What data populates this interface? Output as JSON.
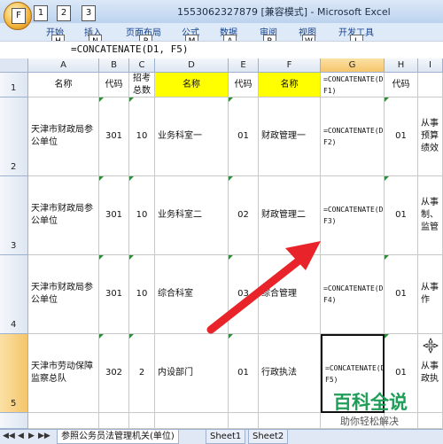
{
  "window": {
    "title": "1553062327879  [兼容模式] - Microsoft Excel",
    "office_key": "F",
    "qat_keys": [
      "1",
      "2",
      "3"
    ]
  },
  "ribbon": {
    "tabs": [
      {
        "label": "开始",
        "key": "H"
      },
      {
        "label": "插入",
        "key": "N"
      },
      {
        "label": "页面布局",
        "key": "P"
      },
      {
        "label": "公式",
        "key": "M"
      },
      {
        "label": "数据",
        "key": "A"
      },
      {
        "label": "审阅",
        "key": "R"
      },
      {
        "label": "视图",
        "key": "W"
      },
      {
        "label": "开发工具",
        "key": "L"
      }
    ]
  },
  "formula_bar": {
    "content": "=CONCATENATE(D1, F5)"
  },
  "columns": [
    "A",
    "B",
    "C",
    "D",
    "E",
    "F",
    "G",
    "H",
    "I"
  ],
  "rows": [
    {
      "num": "1",
      "a": "名称",
      "b": "代码",
      "c": "招考总数",
      "d": "名称",
      "e": "代码",
      "f": "名称",
      "g": "=CONCATENATE(D1, F1)",
      "h": "代码",
      "i": ""
    },
    {
      "num": "2",
      "a": "天津市财政局参公单位",
      "b": "301",
      "c": "10",
      "d": "业务科室一",
      "e": "01",
      "f": "财政管理一",
      "g": "=CONCATENATE(D1, F2)",
      "h": "01",
      "i": "从事预算绩效"
    },
    {
      "num": "3",
      "a": "天津市财政局参公单位",
      "b": "301",
      "c": "10",
      "d": "业务科室二",
      "e": "02",
      "f": "财政管理二",
      "g": "=CONCATENATE(D1, F3)",
      "h": "01",
      "i": "从事制、监管"
    },
    {
      "num": "4",
      "a": "天津市财政局参公单位",
      "b": "301",
      "c": "10",
      "d": "综合科室",
      "e": "03",
      "f": "综合管理",
      "g": "=CONCATENATE(D1, F4)",
      "h": "01",
      "i": "从事作"
    },
    {
      "num": "5",
      "a": "天津市劳动保障监察总队",
      "b": "302",
      "c": "2",
      "d": "内设部门",
      "e": "01",
      "f": "行政执法",
      "g": "=CONCATENATE(D1, F5)",
      "h": "01",
      "i": "从事政执"
    }
  ],
  "sheets": {
    "nav": [
      "◀◀",
      "◀",
      "▶",
      "▶▶"
    ],
    "tabs": [
      "参照公务员法管理机关(单位)",
      "Sheet1",
      "Sheet2"
    ]
  },
  "watermark": {
    "title": "百科全说",
    "subtitle": "助你轻松解决"
  },
  "colors": {
    "yellow_fill": "#ffff00",
    "arrow": "#e8242a",
    "selected_header": "#f5c56b"
  }
}
